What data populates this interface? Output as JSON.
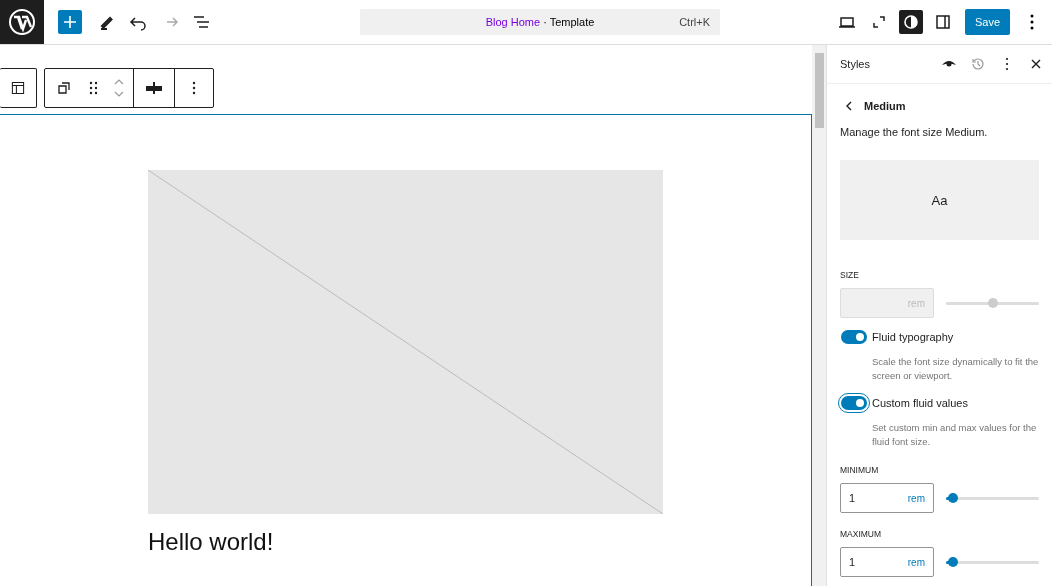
{
  "topbar": {
    "command": {
      "title": "Blog Home",
      "separator": " · ",
      "type": "Template",
      "shortcut": "Ctrl+K"
    },
    "save": "Save",
    "style_toggle_on": true
  },
  "canvas": {
    "post_title": "Hello world!",
    "block_selected": true
  },
  "sidebar": {
    "title": "Styles",
    "back_title": "Medium",
    "description": "Manage the font size Medium.",
    "preview": "Aa",
    "size": {
      "label": "SIZE",
      "unit": "rem",
      "disabled": true,
      "level": 0.5
    },
    "toggles": [
      {
        "label": "Fluid typography",
        "help": "Scale the font size dynamically to fit the screen or viewport.",
        "on": true,
        "focused": false
      },
      {
        "label": "Custom fluid values",
        "help": "Set custom min and max values for the fluid font size.",
        "on": true,
        "focused": true
      }
    ],
    "ranges": [
      {
        "label": "MINIMUM",
        "value": "1",
        "unit": "rem",
        "disabled": false,
        "level": 0.08
      },
      {
        "label": "MAXIMUM",
        "value": "1",
        "unit": "rem",
        "disabled": false,
        "level": 0.08
      }
    ]
  }
}
